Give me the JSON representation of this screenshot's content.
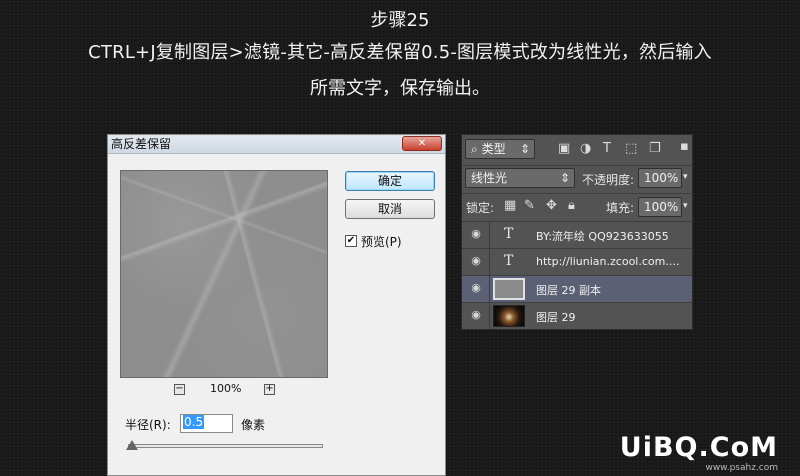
{
  "header": {
    "step": "步骤25",
    "line1": "CTRL+J复制图层>滤镜-其它-高反差保留0.5-图层模式改为线性光，然后输入",
    "line2": "所需文字，保存输出。"
  },
  "dialog": {
    "title": "高反差保留",
    "close_glyph": "✕",
    "ok_label": "确定",
    "cancel_label": "取消",
    "preview_label": "预览(P)",
    "preview_checked": true,
    "zoom_out": "−",
    "zoom_in": "+",
    "zoom_level": "100%",
    "radius_label": "半径(R):",
    "radius_value": "0.5",
    "radius_unit": "像素"
  },
  "layers_panel": {
    "filter_label": "类型",
    "blend_mode": "线性光",
    "opacity_label": "不透明度:",
    "opacity_value": "100%",
    "lock_label": "锁定:",
    "fill_label": "填充:",
    "fill_value": "100%",
    "layers": [
      {
        "type": "text",
        "name": "BY:流年绘 QQ923633055",
        "selected": false
      },
      {
        "type": "text",
        "name": "http://liunian.zcool.com....",
        "selected": false
      },
      {
        "type": "image",
        "name": "图层 29 副本",
        "selected": true
      },
      {
        "type": "image",
        "name": "图层 29",
        "selected": false
      }
    ]
  },
  "watermark": {
    "main": "UiBQ.CoM",
    "sub": "www.psahz.com"
  },
  "colors": {
    "background": "#1c1b1b",
    "panel": "#535353",
    "selected_layer": "#5b6074",
    "dialog": "#f0f0f0"
  }
}
